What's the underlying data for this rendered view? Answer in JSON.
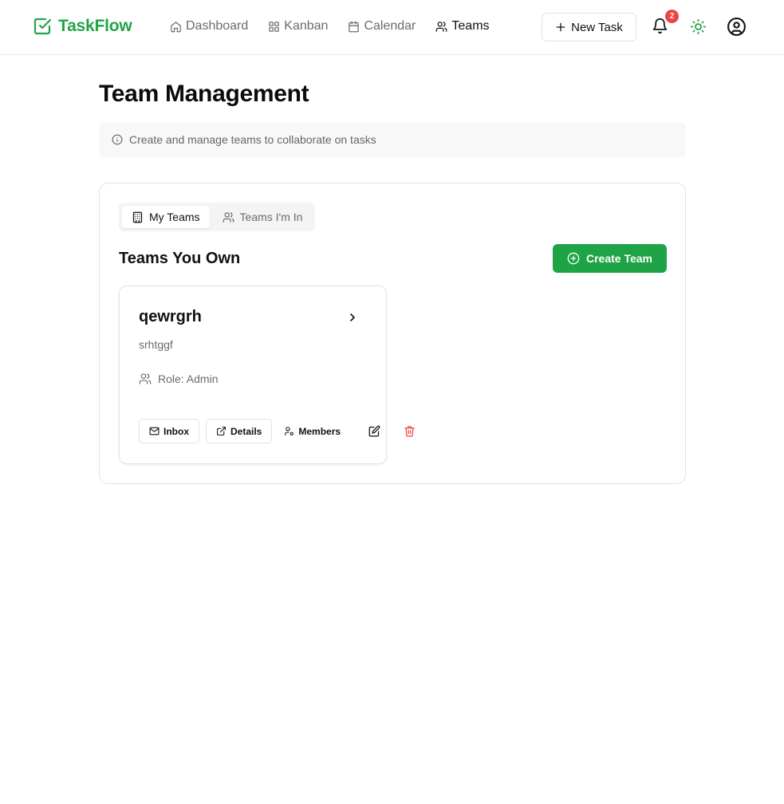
{
  "app": {
    "name": "TaskFlow"
  },
  "nav": {
    "items": [
      {
        "label": "Dashboard",
        "icon": "home-icon"
      },
      {
        "label": "Kanban",
        "icon": "grid-icon"
      },
      {
        "label": "Calendar",
        "icon": "calendar-icon"
      },
      {
        "label": "Teams",
        "icon": "users-icon",
        "active": true
      }
    ]
  },
  "header": {
    "new_task_label": "New Task",
    "notification_count": "2"
  },
  "page": {
    "title": "Team Management",
    "info": "Create and manage teams to collaborate on tasks"
  },
  "tabs": [
    {
      "label": "My Teams",
      "icon": "building-icon",
      "active": true
    },
    {
      "label": "Teams I'm In",
      "icon": "users-icon",
      "active": false
    }
  ],
  "section": {
    "title": "Teams You Own",
    "create_label": "Create Team"
  },
  "team": {
    "name": "qewrgrh",
    "description": "srhtggf",
    "role": "Role: Admin",
    "actions": {
      "inbox": "Inbox",
      "details": "Details",
      "members": "Members"
    }
  },
  "colors": {
    "brand": "#22a447",
    "primary_button": "#1ea446",
    "badge": "#ef4444",
    "delete": "#ef4444"
  }
}
